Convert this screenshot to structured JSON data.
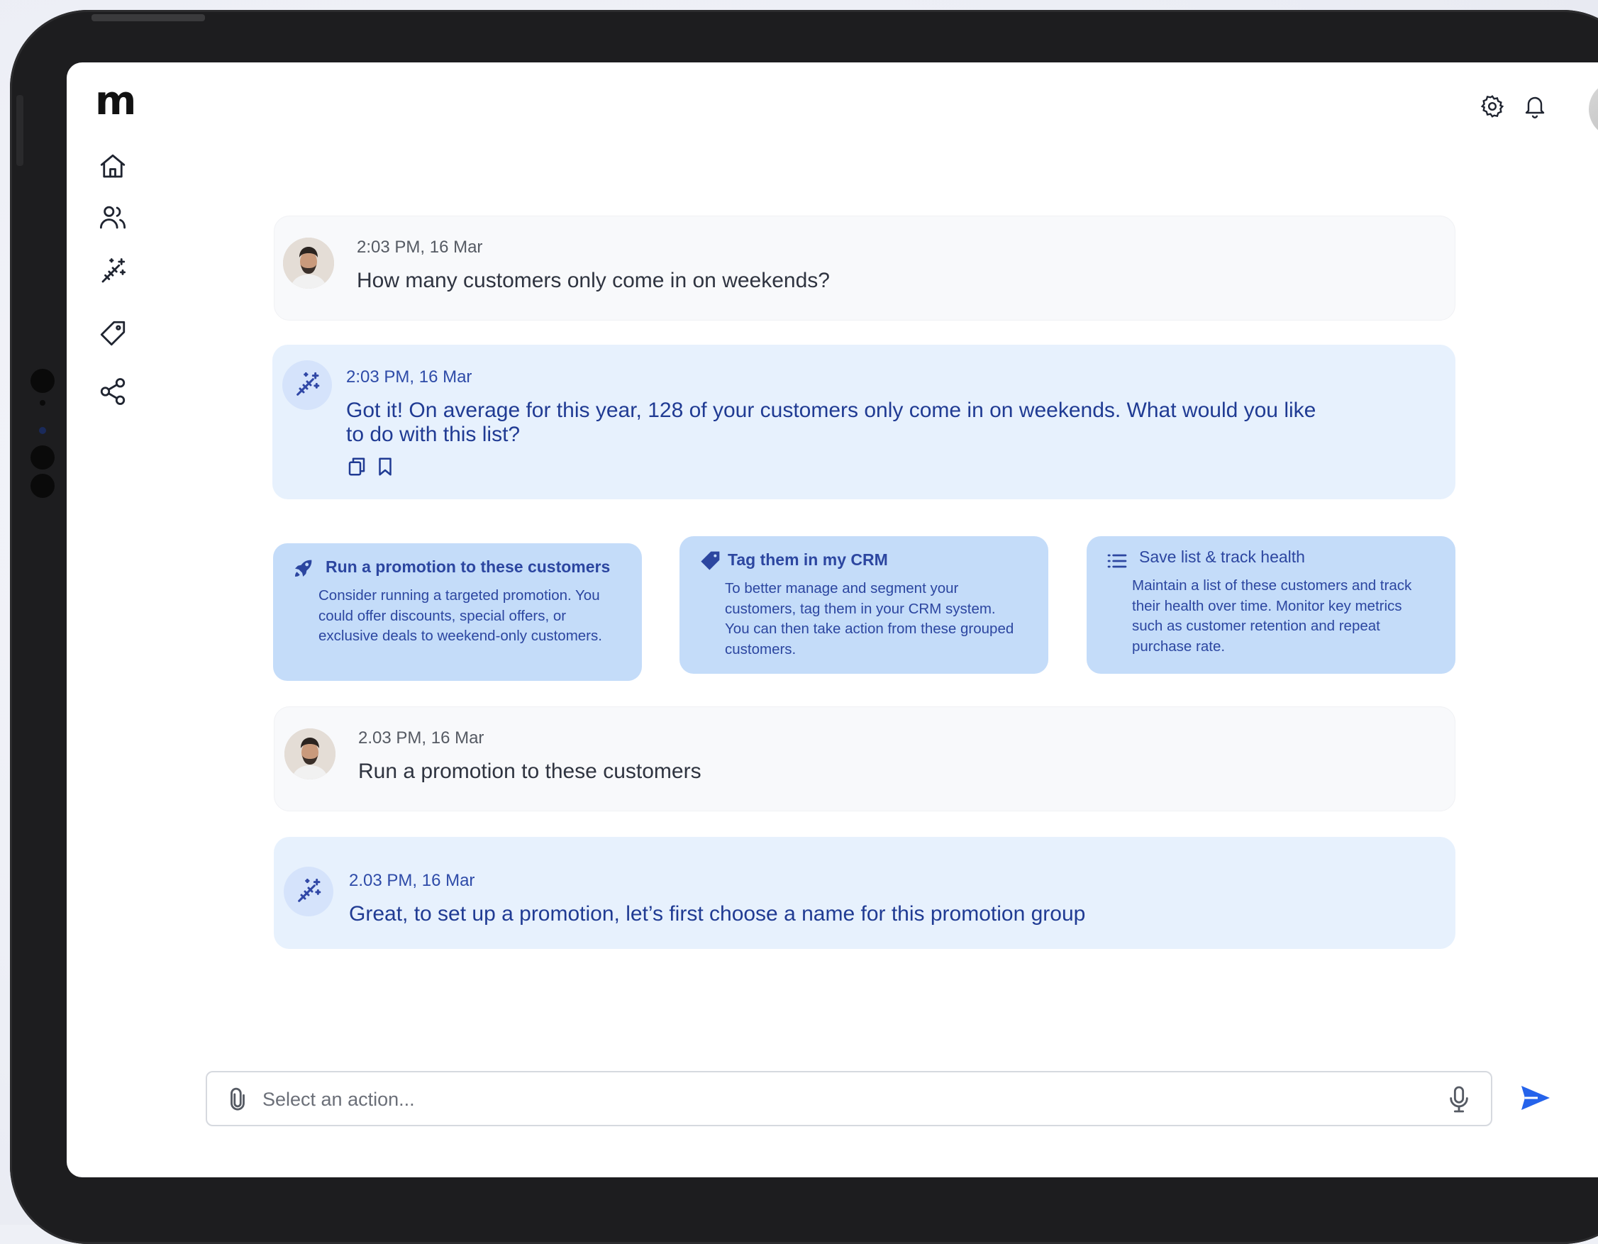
{
  "app": {
    "logo": "m"
  },
  "sidebar": {
    "items": [
      {
        "name": "home-icon"
      },
      {
        "name": "users-icon"
      },
      {
        "name": "magic-wand-icon"
      },
      {
        "name": "tag-icon"
      },
      {
        "name": "share-icon"
      }
    ]
  },
  "topbar": {
    "icons": [
      "gear-icon",
      "bell-icon",
      "avatar"
    ]
  },
  "conversation": {
    "messages": [
      {
        "sender": "user",
        "time": "2:03 PM, 16 Mar",
        "text": "How many customers only come in on weekends?"
      },
      {
        "sender": "assistant",
        "time": "2:03 PM, 16 Mar",
        "text": "Got it! On average for this year, 128 of your customers only come in on weekends. What would you like to do with this list?",
        "actions": [
          "copy-icon",
          "bookmark-icon"
        ]
      },
      {
        "sender": "user",
        "time": "2.03 PM, 16 Mar",
        "text": "Run a promotion to these customers"
      },
      {
        "sender": "assistant",
        "time": "2.03 PM, 16 Mar",
        "text": "Great, to set up a promotion, let’s first choose a name for this promotion group"
      }
    ]
  },
  "suggestions": [
    {
      "icon": "rocket-icon",
      "title": "Run a promotion to these customers",
      "body": "Consider running a targeted promotion. You could offer discounts, special offers, or exclusive deals to weekend-only customers."
    },
    {
      "icon": "tag-filled-icon",
      "title": "Tag them in my CRM",
      "body": "To better manage and segment your customers, tag them in your CRM system. You can then take action from these grouped customers."
    },
    {
      "icon": "list-icon",
      "title": "Save list & track health",
      "body": "Maintain a list of these customers and track their health over time. Monitor key metrics such as customer retention and repeat purchase rate."
    }
  ],
  "composer": {
    "placeholder": "Select an action..."
  },
  "colors": {
    "accent": "#2563eb",
    "bot_bubble": "#e7f1fd",
    "card": "#c4dcf9",
    "bot_text": "#203b93"
  }
}
